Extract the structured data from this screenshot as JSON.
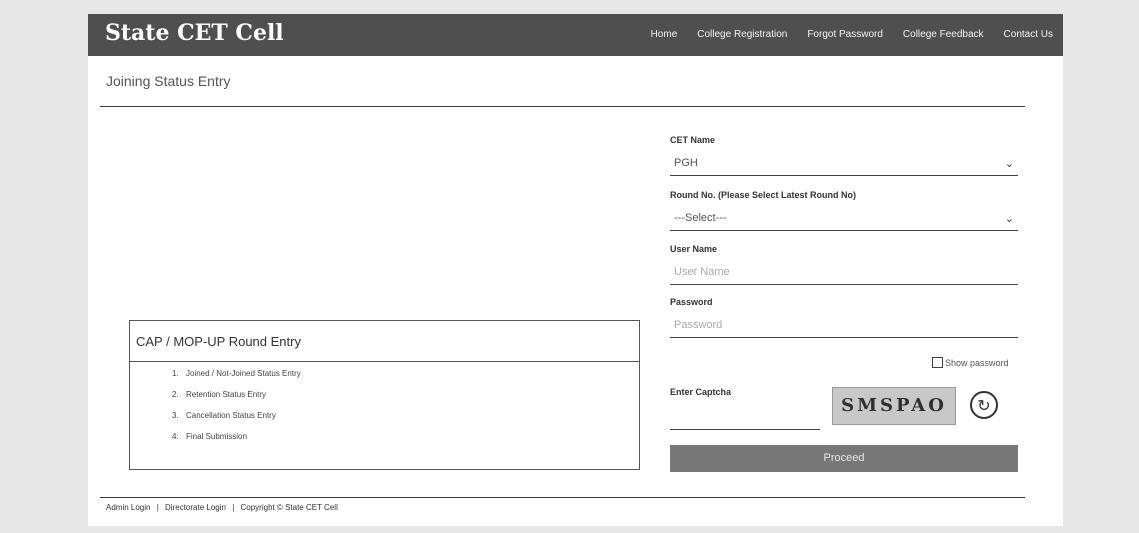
{
  "header": {
    "brand": "State CET Cell",
    "nav": [
      {
        "label": "Home"
      },
      {
        "label": "College Registration"
      },
      {
        "label": "Forgot Password"
      },
      {
        "label": "College Feedback"
      },
      {
        "label": "Contact Us"
      }
    ]
  },
  "page": {
    "title": "Joining Status Entry"
  },
  "form": {
    "cet_label": "CET Name",
    "cet_value": "PGH",
    "round_label": "Round No. (Please Select Latest Round No)",
    "round_value": "---Select---",
    "username_label": "User Name",
    "username_placeholder": "User Name",
    "password_label": "Password",
    "password_placeholder": "Password",
    "show_password": "Show password",
    "captcha_label": "Enter Captcha",
    "captcha_text": "SMSPAO",
    "proceed": "Proceed"
  },
  "round_box": {
    "title": "CAP / MOP-UP Round Entry",
    "items": [
      {
        "num": "1.",
        "label": "Joined / Not-Joined Status Entry"
      },
      {
        "num": "2.",
        "label": "Retention Status Entry"
      },
      {
        "num": "3.",
        "label": "Cancellation Status Entry"
      },
      {
        "num": "4.",
        "label": "Final Submission"
      }
    ]
  },
  "footer": {
    "admin": "Admin Login",
    "sep": "|",
    "directorate": "Directorate Login",
    "copyright": "Copyright © State CET Cell"
  },
  "icons": {
    "dropdown": "chevron-down-icon",
    "refresh": "refresh-icon"
  }
}
